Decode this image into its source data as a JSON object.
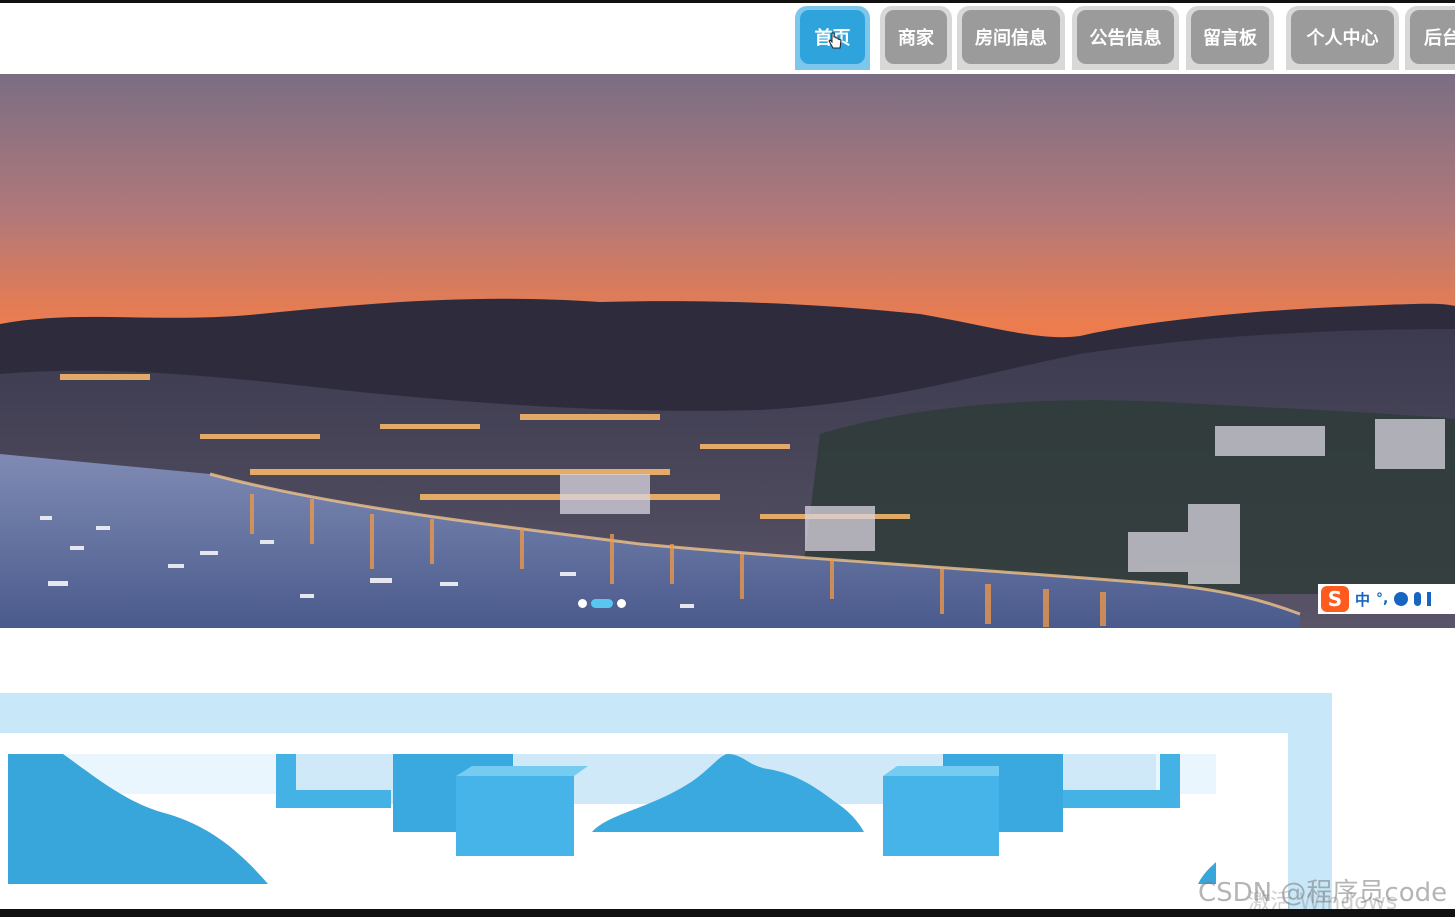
{
  "nav": {
    "items": [
      {
        "label": "首页",
        "active": true
      },
      {
        "label": "商家",
        "active": false
      },
      {
        "label": "房间信息",
        "active": false
      },
      {
        "label": "公告信息",
        "active": false
      },
      {
        "label": "留言板",
        "active": false
      },
      {
        "label": "个人中心",
        "active": false
      },
      {
        "label": "后台",
        "active": false
      }
    ],
    "colors": {
      "active": "#2fa3dc",
      "inactive": "#9b9b9b",
      "text": "#ffffff"
    }
  },
  "carousel": {
    "slide_count": 3,
    "active_slide_index": 1,
    "indicator_color": "#58c6ef"
  },
  "ime_toolbar": {
    "logo": "S",
    "lang": "中",
    "punct": "°,",
    "icons": [
      "emoji-icon",
      "mic-icon",
      "more-icon"
    ]
  },
  "watermark": {
    "text": "CSDN @程序员code",
    "overlay": "激活 Windows"
  }
}
